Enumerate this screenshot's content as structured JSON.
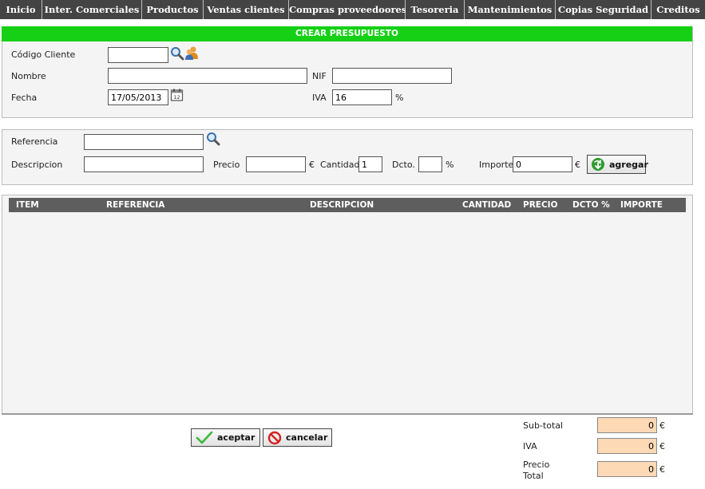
{
  "nav": [
    "Inicio",
    "Inter. Comerciales",
    "Productos",
    "Ventas clientes",
    "Compras proveedoores",
    "Tesoreria",
    "Mantenimientos",
    "Copias Seguridad",
    "Creditos"
  ],
  "form": {
    "title": "CREAR PRESUPUESTO",
    "codigo_cliente_label": "Código Cliente",
    "codigo_cliente_value": "",
    "nombre_label": "Nombre",
    "nombre_value": "",
    "nif_label": "NIF",
    "nif_value": "",
    "fecha_label": "Fecha",
    "fecha_value": "17/05/2013",
    "iva_label": "IVA",
    "iva_value": "16",
    "iva_unit": "%"
  },
  "line": {
    "referencia_label": "Referencia",
    "referencia_value": "",
    "descripcion_label": "Descripcion",
    "descripcion_value": "",
    "precio_label": "Precio",
    "precio_value": "",
    "currency": "€",
    "cantidad_label": "Cantidad",
    "cantidad_value": "1",
    "dcto_label": "Dcto.",
    "dcto_value": "",
    "percent": "%",
    "importe_label": "Importe",
    "importe_value": "0",
    "agregar_label": "agregar"
  },
  "table": {
    "columns": [
      "ITEM",
      "REFERENCIA",
      "DESCRIPCION",
      "CANTIDAD",
      "PRECIO",
      "DCTO %",
      "IMPORTE"
    ],
    "rows": []
  },
  "actions": {
    "aceptar_label": "aceptar",
    "cancelar_label": "cancelar"
  },
  "totals": {
    "subtotal_label": "Sub-total",
    "subtotal_value": "0",
    "iva_label": "IVA",
    "iva_value": "0",
    "precio_total_label_1": "Precio",
    "precio_total_label_2": "Total",
    "precio_total_value": "0",
    "currency": "€"
  },
  "colors": {
    "title_bar": "#16d016",
    "nav_bg": "#444444",
    "table_header": "#5e5e5e",
    "total_field": "#fdd9b5"
  },
  "icons": [
    "search-icon",
    "users-icon",
    "calendar-icon",
    "add-icon",
    "check-icon",
    "cancel-icon"
  ]
}
